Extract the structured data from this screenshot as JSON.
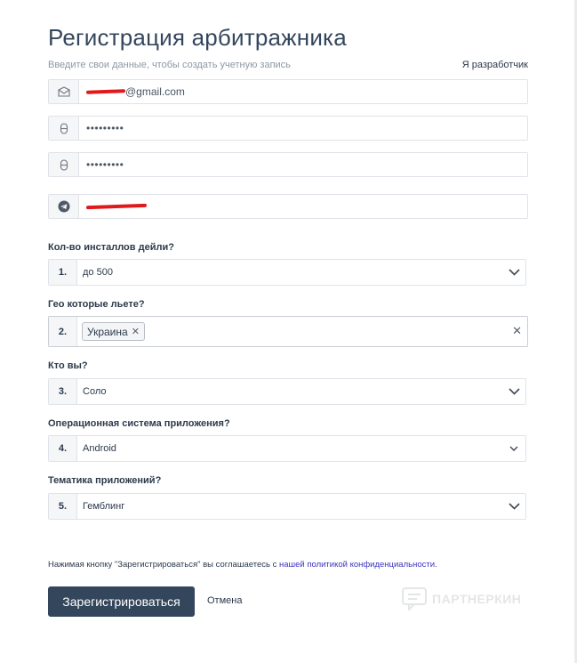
{
  "header": {
    "title": "Регистрация арбитражника",
    "subtitle": "Введите свои данные, чтобы создать учетную запись",
    "developer_link": "Я разработчик"
  },
  "fields": {
    "email_suffix": "@gmail.com",
    "password": "•••••••••",
    "password_confirm": "•••••••••"
  },
  "questions": [
    {
      "label": "Кол-во инсталлов дейли?",
      "num": "1.",
      "value": "до 500"
    },
    {
      "label": "Гео которые льете?",
      "num": "2.",
      "tags": [
        "Украина"
      ]
    },
    {
      "label": "Кто вы?",
      "num": "3.",
      "value": "Соло"
    },
    {
      "label": "Операционная система приложения?",
      "num": "4.",
      "value": "Android"
    },
    {
      "label": "Тематика приложений?",
      "num": "5.",
      "value": "Гемблинг"
    }
  ],
  "footer": {
    "policy_text": "Нажимая кнопку \"Зарегистрироваться\" вы соглашаетесь с ",
    "policy_link": "нашей политикой конфиденциальности.",
    "register_button": "Зарегистрироваться",
    "cancel_button": "Отмена"
  },
  "watermark": {
    "text": "ПАРТНЕРКИН"
  },
  "icons": {
    "email": "envelope-icon",
    "password": "lock-icon",
    "telegram": "telegram-icon",
    "dropdown": "chevron-down-icon",
    "remove": "close-icon"
  },
  "colors": {
    "primary": "#34465c",
    "link": "#3b34c0",
    "redaction": "#e0191c"
  }
}
